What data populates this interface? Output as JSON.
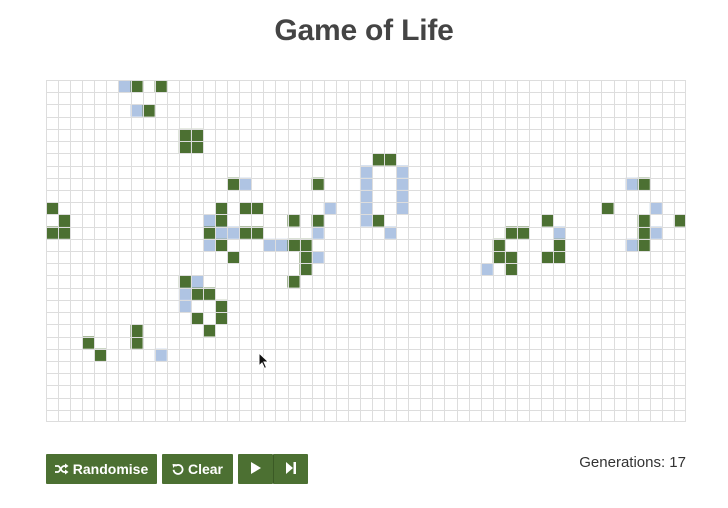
{
  "title": "Game of Life",
  "board": {
    "cols": 53,
    "rows": 28,
    "colors": {
      "alive": "#4c7032",
      "dying": "#afc4e3",
      "grid": "#dddddd"
    },
    "alive": [
      [
        7,
        0
      ],
      [
        9,
        0
      ],
      [
        8,
        2
      ],
      [
        11,
        4
      ],
      [
        12,
        4
      ],
      [
        11,
        5
      ],
      [
        12,
        5
      ],
      [
        27,
        6
      ],
      [
        28,
        6
      ],
      [
        15,
        8
      ],
      [
        22,
        8
      ],
      [
        49,
        8
      ],
      [
        0,
        10
      ],
      [
        14,
        10
      ],
      [
        16,
        10
      ],
      [
        17,
        10
      ],
      [
        46,
        10
      ],
      [
        1,
        11
      ],
      [
        14,
        11
      ],
      [
        20,
        11
      ],
      [
        22,
        11
      ],
      [
        27,
        11
      ],
      [
        41,
        11
      ],
      [
        49,
        11
      ],
      [
        52,
        11
      ],
      [
        0,
        12
      ],
      [
        1,
        12
      ],
      [
        13,
        12
      ],
      [
        16,
        12
      ],
      [
        17,
        12
      ],
      [
        38,
        12
      ],
      [
        39,
        12
      ],
      [
        49,
        12
      ],
      [
        14,
        13
      ],
      [
        20,
        13
      ],
      [
        21,
        13
      ],
      [
        37,
        13
      ],
      [
        42,
        13
      ],
      [
        49,
        13
      ],
      [
        15,
        14
      ],
      [
        21,
        14
      ],
      [
        37,
        14
      ],
      [
        38,
        14
      ],
      [
        41,
        14
      ],
      [
        42,
        14
      ],
      [
        21,
        15
      ],
      [
        38,
        15
      ],
      [
        11,
        16
      ],
      [
        20,
        16
      ],
      [
        12,
        17
      ],
      [
        13,
        17
      ],
      [
        14,
        18
      ],
      [
        12,
        19
      ],
      [
        14,
        19
      ],
      [
        7,
        20
      ],
      [
        13,
        20
      ],
      [
        3,
        21
      ],
      [
        7,
        21
      ],
      [
        4,
        22
      ]
    ],
    "dying": [
      [
        6,
        0
      ],
      [
        7,
        2
      ],
      [
        26,
        7
      ],
      [
        29,
        7
      ],
      [
        26,
        8
      ],
      [
        29,
        8
      ],
      [
        16,
        8
      ],
      [
        48,
        8
      ],
      [
        26,
        9
      ],
      [
        29,
        9
      ],
      [
        26,
        10
      ],
      [
        29,
        10
      ],
      [
        23,
        10
      ],
      [
        50,
        10
      ],
      [
        26,
        11
      ],
      [
        13,
        11
      ],
      [
        14,
        12
      ],
      [
        15,
        12
      ],
      [
        22,
        12
      ],
      [
        28,
        12
      ],
      [
        42,
        12
      ],
      [
        50,
        12
      ],
      [
        13,
        13
      ],
      [
        18,
        13
      ],
      [
        19,
        13
      ],
      [
        48,
        13
      ],
      [
        15,
        14
      ],
      [
        22,
        14
      ],
      [
        36,
        15
      ],
      [
        12,
        16
      ],
      [
        11,
        17
      ],
      [
        11,
        18
      ],
      [
        13,
        20
      ],
      [
        9,
        22
      ]
    ]
  },
  "controls": {
    "randomise": "Randomise",
    "clear": "Clear",
    "play_icon": "play-icon",
    "step_icon": "step-forward-icon"
  },
  "status": {
    "generations": "Generations: 17"
  }
}
